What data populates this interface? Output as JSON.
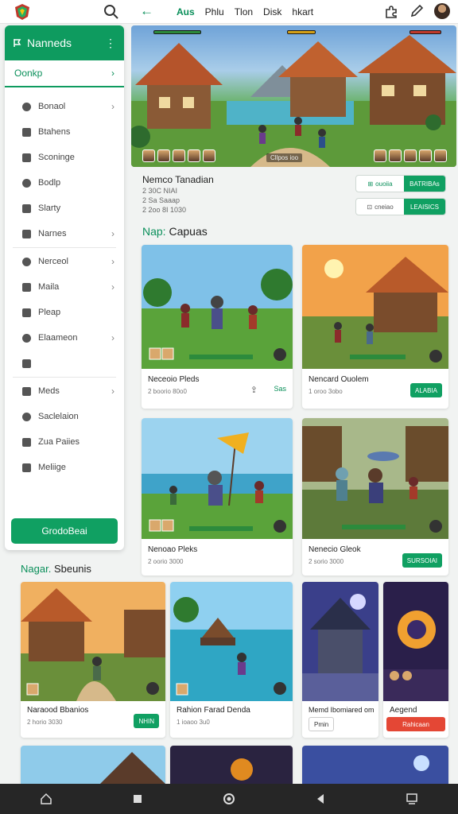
{
  "topbar": {
    "nav": [
      "Aus",
      "Phlu",
      "Tlon",
      "Disk",
      "hkart"
    ],
    "icons": [
      "app-logo-icon",
      "search-icon",
      "back-arrow-icon",
      "puzzle-icon",
      "pen-icon",
      "avatar"
    ]
  },
  "sidebar": {
    "title": "Nanneds",
    "dots": "⋮",
    "subtitle": "Oonkp",
    "items": [
      {
        "label": "Bonaol",
        "chevron": true
      },
      {
        "label": "Btahens",
        "chevron": false
      },
      {
        "label": "Sconinge",
        "chevron": false
      },
      {
        "label": "Bodlp",
        "chevron": false
      },
      {
        "label": "Slarty",
        "chevron": false
      },
      {
        "label": "Narnes",
        "chevron": true
      },
      {
        "label": "Nerceol",
        "chevron": true
      },
      {
        "label": "Maila",
        "chevron": true
      },
      {
        "label": "Pleap",
        "chevron": false
      },
      {
        "label": "Elaameon",
        "chevron": true
      },
      {
        "label": "",
        "chevron": false
      },
      {
        "label": "Meds",
        "chevron": true
      },
      {
        "label": "Saclelaion",
        "chevron": false
      },
      {
        "label": "Zua Paiies",
        "chevron": false
      },
      {
        "label": "Meliige",
        "chevron": false
      }
    ],
    "button": "GrodoBeai"
  },
  "hero": {
    "tag": "Cllpos ioo"
  },
  "info": {
    "title": "Nemco Tanadian",
    "sub1": "2 30C NIAI",
    "sub2": "2 Sa Saaap",
    "sub3": "2 2oo 8I 1030",
    "pill1_left": "ouoiia",
    "pill1_right": "BATRIBAs",
    "pill2_left": "cneiao",
    "pill2_right": "LEAISICS"
  },
  "section1": {
    "prefix": "Nap:",
    "title": "Capuas"
  },
  "cards": [
    {
      "title": "Neceoio Pleds",
      "sub": "2 boorio 80o0",
      "btn": "Sas"
    },
    {
      "title": "Nencard Ouolem",
      "sub": "1 oroo 3obo",
      "btn": "ALABIA"
    },
    {
      "title": "Nenoao Pleks",
      "sub": "2 oorio 3000",
      "btn": ""
    },
    {
      "title": "Nenecio Gleok",
      "sub": "2 sorio 3000",
      "btn": "SURSOIAI"
    }
  ],
  "section2": {
    "prefix": "Nagar.",
    "title": "Sbeunis"
  },
  "cards2": [
    {
      "title": "Naraood Bbanios",
      "sub": "2 horio 3030",
      "btn": "NHIN"
    },
    {
      "title": "Rahion Farad Denda",
      "sub": "1 ioaoo 3u0",
      "btn": ""
    },
    {
      "title": "Memd Ibomiared om",
      "sub": "",
      "btn": "Pmin"
    },
    {
      "title": "Aegend",
      "sub": "",
      "btn": "Rahicaan"
    }
  ],
  "navbar": [
    "home-icon",
    "square-icon",
    "circle-icon",
    "triangle-back-icon",
    "recents-icon"
  ],
  "colors": {
    "accent": "#10a062",
    "danger": "#e44735"
  }
}
